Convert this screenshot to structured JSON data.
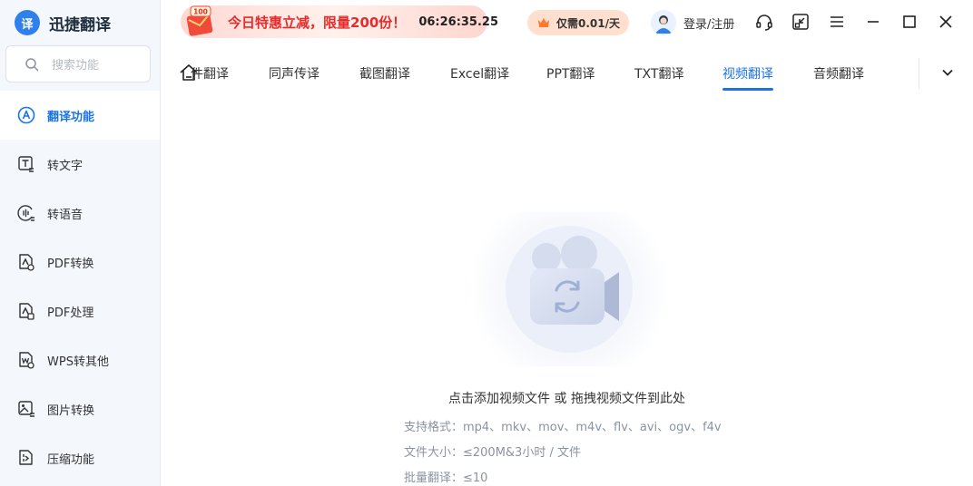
{
  "app": {
    "name": "迅捷翻译",
    "logo_char": "译"
  },
  "search": {
    "placeholder": "搜索功能"
  },
  "sidebar": {
    "items": [
      {
        "label": "翻译功能",
        "icon": "translate-icon",
        "active": true
      },
      {
        "label": "转文字",
        "icon": "text-convert-icon",
        "active": false
      },
      {
        "label": "转语音",
        "icon": "voice-icon",
        "active": false
      },
      {
        "label": "PDF转换",
        "icon": "pdf-convert-icon",
        "active": false
      },
      {
        "label": "PDF处理",
        "icon": "pdf-process-icon",
        "active": false
      },
      {
        "label": "WPS转其他",
        "icon": "wps-icon",
        "active": false
      },
      {
        "label": "图片转换",
        "icon": "image-convert-icon",
        "active": false
      },
      {
        "label": "压缩功能",
        "icon": "compress-icon",
        "active": false
      }
    ]
  },
  "promo": {
    "badge": "100",
    "text": "今日特惠立减，限量200份！",
    "timer": "06:26:35.25"
  },
  "price": {
    "label": "仅需0.01/天"
  },
  "user": {
    "login_label": "登录/注册"
  },
  "tabs": [
    {
      "label": "件翻译",
      "active": false
    },
    {
      "label": "同声传译",
      "active": false
    },
    {
      "label": "截图翻译",
      "active": false
    },
    {
      "label": "Excel翻译",
      "active": false
    },
    {
      "label": "PPT翻译",
      "active": false
    },
    {
      "label": "TXT翻译",
      "active": false
    },
    {
      "label": "视频翻译",
      "active": true
    },
    {
      "label": "音频翻译",
      "active": false
    }
  ],
  "upload": {
    "title": "点击添加视频文件 或 拖拽视频文件到此处",
    "formats": "支持格式：mp4、mkv、mov、m4v、flv、avi、ogv、f4v",
    "size": "文件大小：≤200M&3小时 / 文件",
    "batch": "批量翻译：≤10"
  },
  "colors": {
    "accent": "#1a73e8",
    "promo_red": "#e52b2b",
    "sidebar_bg": "#f4f7fb"
  }
}
